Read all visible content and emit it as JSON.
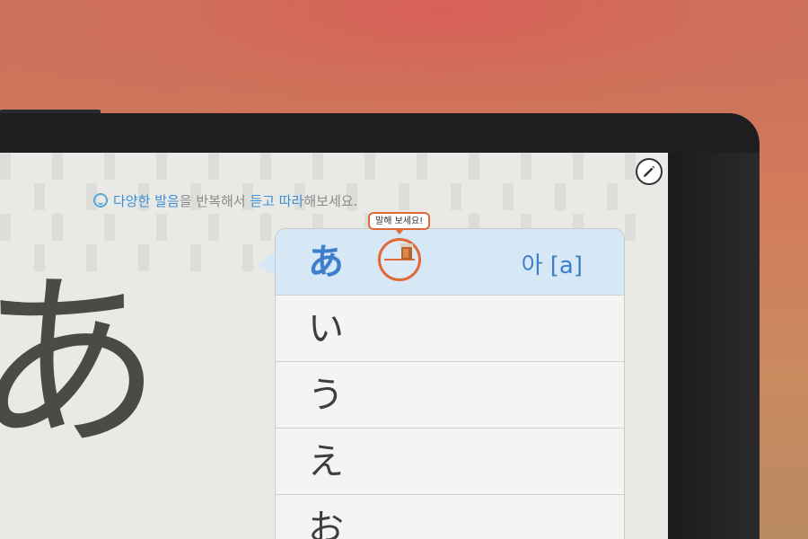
{
  "instruction": {
    "part1": "다양한",
    "part2": "발음",
    "part3": "을 반복해서",
    "part4": "듣고",
    "part5": "따라",
    "part6": "해보세요."
  },
  "large_character": "あ",
  "tooltip": "말해 보세요!",
  "rows": [
    {
      "kana": "あ",
      "reading": "아 [a]",
      "selected": true
    },
    {
      "kana": "い"
    },
    {
      "kana": "う"
    },
    {
      "kana": "え"
    },
    {
      "kana": "お"
    }
  ],
  "icons": {
    "edit": "pencil-icon",
    "instruction": "smiley-icon",
    "record": "microphone-icon"
  },
  "colors": {
    "accent_blue": "#3d7fcc",
    "accent_orange": "#e06a36",
    "selected_row": "#d6e7f6"
  }
}
